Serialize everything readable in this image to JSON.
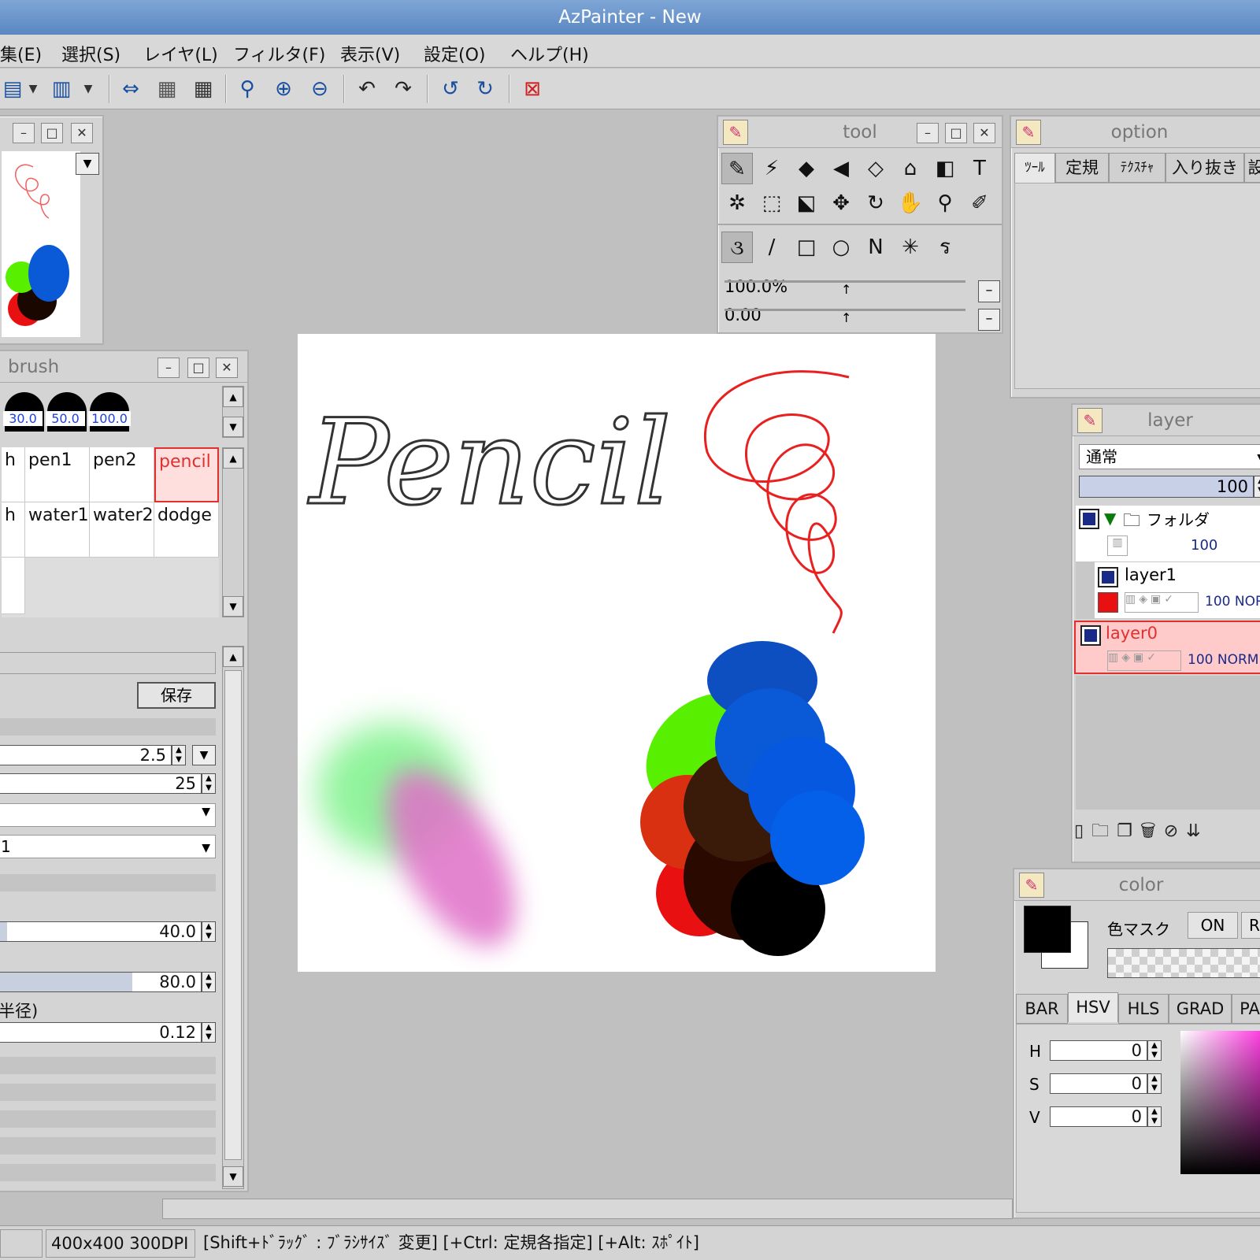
{
  "window": {
    "title": "AzPainter - New"
  },
  "menu": [
    "集(E)",
    "選択(S)",
    "レイヤ(L)",
    "フィルタ(F)",
    "表示(V)",
    "設定(O)",
    "ヘルプ(H)"
  ],
  "tool_panel": {
    "title": "tool",
    "opacity_value": "100.0%",
    "second_value": "0.00"
  },
  "option_panel": {
    "title": "option",
    "tabs": [
      "ﾂｰﾙ",
      "定規",
      "ﾃｸｽﾁｬ",
      "入り抜き",
      "設"
    ]
  },
  "brush_panel": {
    "title": "brush",
    "sizes": [
      "30.0",
      "50.0",
      "100.0"
    ],
    "row1": [
      "h",
      "pen1",
      "pen2",
      "pencil"
    ],
    "row2": [
      "h",
      "water1",
      "water2",
      "dodge"
    ],
    "save_label": "保存",
    "fields": {
      "size": "2.5",
      "density": "25",
      "dropdown2": "1",
      "val40": "40.0",
      "val80": "80.0",
      "radius_label": "半径)",
      "val012": "0.12"
    }
  },
  "layer_panel": {
    "title": "layer",
    "blend_mode": "通常",
    "opacity": "100",
    "folder": {
      "name": "フォルダ",
      "opacity": "100"
    },
    "layers": [
      {
        "name": "layer1",
        "info": "100 NOR"
      },
      {
        "name": "layer0",
        "info": "100 NORM"
      }
    ]
  },
  "color_panel": {
    "title": "color",
    "mask_label": "色マスク",
    "mask_on": "ON",
    "mask_r": "R",
    "tabs": [
      "BAR",
      "HSV",
      "HLS",
      "GRAD",
      "PA"
    ],
    "h_label": "H",
    "h": "0",
    "s_label": "S",
    "s": "0",
    "v_label": "V",
    "v": "0",
    "foreground": "#000000",
    "background": "#ffffff"
  },
  "canvas": {
    "text": "Pencil"
  },
  "status": {
    "size": "400x400 300DPI",
    "hint": "[Shift+ﾄﾞﾗｯｸﾞ : ﾌﾞﾗｼｻｲｽﾞ 変更] [+Ctrl: 定規各指定] [+Alt: ｽﾎﾟｲﾄ]"
  }
}
